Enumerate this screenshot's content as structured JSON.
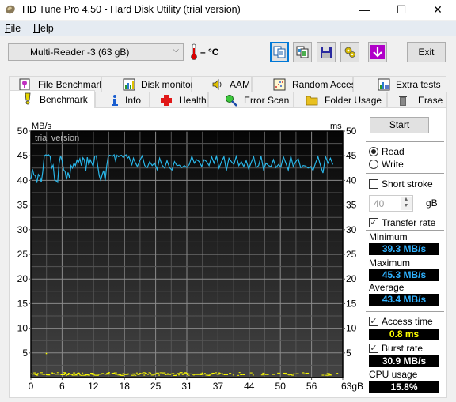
{
  "window": {
    "title": "HD Tune Pro 4.50 - Hard Disk Utility (trial version)",
    "controls": {
      "minimize": "—",
      "maximize": "☐",
      "close": "✕"
    }
  },
  "menu": [
    {
      "label": "File",
      "accel": "F",
      "rest": "ile"
    },
    {
      "label": "Help",
      "accel": "H",
      "rest": "elp"
    }
  ],
  "toolbar": {
    "drive": "Multi-Reader  -3 (63 gB)",
    "temperature": "– °C",
    "buttons": [
      {
        "name": "copy-text-button",
        "icon": "copy-text-icon",
        "selected": true
      },
      {
        "name": "copy-screenshot-button",
        "icon": "copy-image-icon",
        "selected": false
      },
      {
        "name": "save-button",
        "icon": "floppy-disk-icon",
        "selected": false
      },
      {
        "name": "options-button",
        "icon": "gears-icon",
        "selected": false
      },
      {
        "name": "download-button",
        "icon": "download-arrow-icon",
        "selected": false
      }
    ],
    "exit_label": "Exit"
  },
  "tabs": {
    "back_row": [
      {
        "label": "File Benchmark",
        "icon": "file-benchmark-icon"
      },
      {
        "label": "Disk monitor",
        "icon": "disk-monitor-icon"
      },
      {
        "label": "AAM",
        "icon": "speaker-icon"
      },
      {
        "label": "Random Access",
        "icon": "random-access-icon"
      },
      {
        "label": "Extra tests",
        "icon": "extra-tests-icon"
      }
    ],
    "front_row": [
      {
        "label": "Benchmark",
        "icon": "benchmark-icon",
        "active": true
      },
      {
        "label": "Info",
        "icon": "info-icon",
        "active": false
      },
      {
        "label": "Health",
        "icon": "health-cross-icon",
        "active": false
      },
      {
        "label": "Error Scan",
        "icon": "magnifier-icon",
        "active": false
      },
      {
        "label": "Folder Usage",
        "icon": "folder-icon",
        "active": false
      },
      {
        "label": "Erase",
        "icon": "trash-icon",
        "active": false
      }
    ]
  },
  "side": {
    "start_label": "Start",
    "read_label": "Read",
    "write_label": "Write",
    "mode": "read",
    "short_stroke_label": "Short stroke",
    "short_stroke_checked": false,
    "short_stroke_value": "40",
    "short_stroke_unit": "gB",
    "transfer_rate_label": "Transfer rate",
    "transfer_rate_checked": true,
    "minimum_label": "Minimum",
    "minimum_value": "39.3 MB/s",
    "maximum_label": "Maximum",
    "maximum_value": "45.3 MB/s",
    "average_label": "Average",
    "average_value": "43.4 MB/s",
    "access_time_label": "Access time",
    "access_time_checked": true,
    "access_time_value": "0.8 ms",
    "burst_rate_label": "Burst rate",
    "burst_rate_checked": true,
    "burst_rate_value": "30.9 MB/s",
    "cpu_usage_label": "CPU usage",
    "cpu_usage_value": "15.8%",
    "colors": {
      "transfer": "#00c8ff",
      "access": "#ffff00",
      "white": "#ffffff"
    }
  },
  "chart_data": {
    "type": "line",
    "watermark": "trial version",
    "y_left_label": "MB/s",
    "y_right_label": "ms",
    "x_unit": "gB",
    "xlim": [
      0,
      63
    ],
    "ylim_left": [
      0,
      50
    ],
    "ylim_right": [
      0,
      50
    ],
    "x_ticks": [
      0,
      6,
      12,
      18,
      25,
      31,
      37,
      44,
      50,
      56,
      63
    ],
    "x_tick_labels": [
      "0",
      "6",
      "12",
      "18",
      "25",
      "31",
      "37",
      "44",
      "50",
      "56",
      "63gB"
    ],
    "y_ticks": [
      5,
      10,
      15,
      20,
      25,
      30,
      35,
      40,
      45,
      50
    ],
    "grid": true,
    "series": [
      {
        "name": "Transfer rate",
        "axis": "left",
        "color": "#29b6e8",
        "x": [
          0,
          0.3,
          0.6,
          0.9,
          1.2,
          1.5,
          1.8,
          2.1,
          2.4,
          2.7,
          3.0,
          3.3,
          3.6,
          3.9,
          4.2,
          4.5,
          4.8,
          5.1,
          5.4,
          5.7,
          6.0,
          6.3,
          6.6,
          6.9,
          7.2,
          7.5,
          7.8,
          8.1,
          8.4,
          8.7,
          9.0,
          9.3,
          9.6,
          9.9,
          10.2,
          10.5,
          10.8,
          11.1,
          11.4,
          11.7,
          12.0,
          12.3,
          12.6,
          12.9,
          13.2,
          13.5,
          13.8,
          14.1,
          14.4,
          14.7,
          15.0,
          15.3,
          15.6,
          15.9,
          16.2,
          16.5,
          16.8,
          17.1,
          17.4,
          17.7,
          18.0,
          18.3,
          18.6,
          18.9,
          19.2,
          19.5,
          19.8,
          20.1,
          20.4,
          20.7,
          21.0,
          21.5,
          22.0,
          22.5,
          23.0,
          23.5,
          24.0,
          24.5,
          25.0,
          25.5,
          26.0,
          26.5,
          27.0,
          27.5,
          28.0,
          28.5,
          29.0,
          29.5,
          30.0,
          30.5,
          31.0,
          31.5,
          32.0,
          32.5,
          33.0,
          33.5,
          34.0,
          34.5,
          35.0,
          35.5,
          36.0,
          36.5,
          37.0,
          37.5,
          38.0,
          38.5,
          39.0,
          39.5,
          40.0,
          40.5,
          41.0,
          41.5,
          42.0,
          42.5,
          43.0,
          43.5,
          44.0,
          44.5,
          45.0,
          45.5,
          46.0,
          46.5,
          47.0,
          47.5,
          48.0,
          48.5,
          49.0,
          49.5,
          50.0,
          50.5,
          51.0,
          51.5,
          52.0,
          52.5,
          53.0,
          53.5,
          54.0,
          54.5,
          55.0,
          55.5,
          56.0,
          56.5,
          57.0,
          57.5,
          58.0,
          58.5,
          59.0,
          59.5,
          60.0,
          60.5,
          61.0,
          61.5,
          62.0,
          62.5,
          63.0
        ],
        "values": [
          40.2,
          42.3,
          41.1,
          41.0,
          39.5,
          41.2,
          40.8,
          39.6,
          41.8,
          45.0,
          45.2,
          45.1,
          45.2,
          44.8,
          42.5,
          43.1,
          40.1,
          39.9,
          39.6,
          43.5,
          45.0,
          44.0,
          42.2,
          41.8,
          40.2,
          41.6,
          40.5,
          43.0,
          42.5,
          43.5,
          43.0,
          44.1,
          43.6,
          44.4,
          43.0,
          44.6,
          44.2,
          42.0,
          44.7,
          43.1,
          44.2,
          43.5,
          42.8,
          44.9,
          45.0,
          43.0,
          41.0,
          40.0,
          41.2,
          42.0,
          39.9,
          42.8,
          44.8,
          45.1,
          45.0,
          44.9,
          45.2,
          44.0,
          45.1,
          44.8,
          45.0,
          45.1,
          44.7,
          44.9,
          45.2,
          44.5,
          44.8,
          44.0,
          43.2,
          44.5,
          43.8,
          42.8,
          44.0,
          45.0,
          43.0,
          42.6,
          43.8,
          43.0,
          43.5,
          42.2,
          44.5,
          43.1,
          42.5,
          44.0,
          42.6,
          42.1,
          43.8,
          43.0,
          43.1,
          42.6,
          43.0,
          42.6,
          43.2,
          44.9,
          43.5,
          44.2,
          43.8,
          42.8,
          44.2,
          43.8,
          43.0,
          44.8,
          43.5,
          44.9,
          42.5,
          43.8,
          44.8,
          42.0,
          44.5,
          43.8,
          43.2,
          44.9,
          43.0,
          43.8,
          42.8,
          44.0,
          42.3,
          43.6,
          44.8,
          42.6,
          43.0,
          44.9,
          42.2,
          43.5,
          43.0,
          42.8,
          44.2,
          42.6,
          43.2,
          42.7,
          44.8,
          43.5,
          42.1,
          44.9,
          42.8,
          43.8,
          44.4,
          42.6,
          43.0,
          42.9,
          42.5,
          42.8,
          42.0,
          43.5,
          44.8,
          43.0,
          41.5,
          44.9,
          43.5,
          44.5,
          43.2
        ]
      },
      {
        "name": "Access time",
        "axis": "right",
        "color": "#ffff00",
        "type": "scatter",
        "points_note": "dense cluster near 0.6–1.0 ms across 0–62 gB, one outlier",
        "outlier": {
          "x": 3.0,
          "y": 5.0
        },
        "band": [
          0.5,
          1.1
        ]
      }
    ]
  }
}
